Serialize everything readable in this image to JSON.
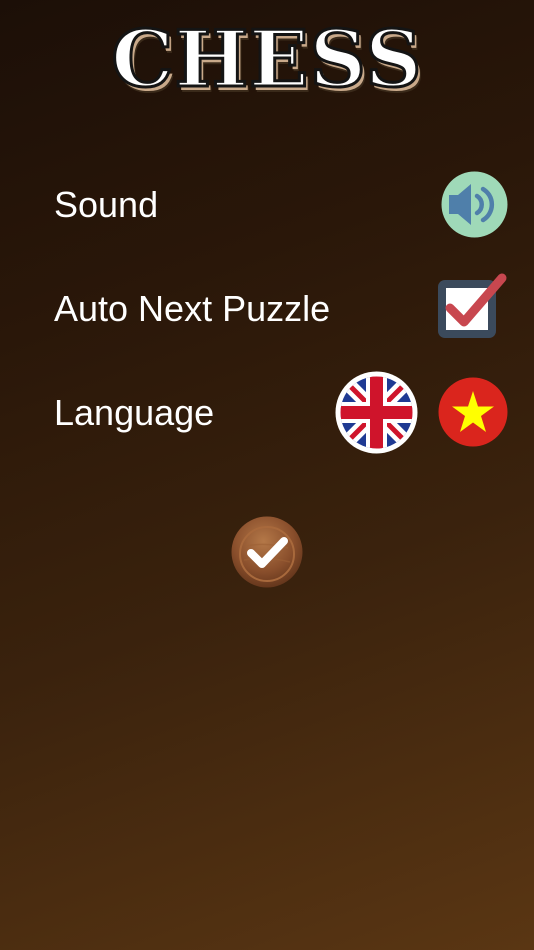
{
  "app": {
    "title": "CHESS"
  },
  "settings": {
    "sound": {
      "label": "Sound",
      "icon": "speaker-icon",
      "enabled": true
    },
    "auto_next": {
      "label": "Auto Next Puzzle",
      "icon": "checkbox-checked-icon",
      "checked": true
    },
    "language": {
      "label": "Language",
      "options": [
        {
          "code": "en",
          "icon": "uk-flag-icon"
        },
        {
          "code": "vi",
          "icon": "vietnam-flag-icon"
        }
      ]
    }
  },
  "confirm": {
    "icon": "checkmark-icon"
  },
  "colors": {
    "sound_bg": "#9fd9b8",
    "speaker": "#4f7faa",
    "checkbox_frame": "#3b4a5c",
    "checkmark": "#c8474f",
    "vn_red": "#da251d",
    "vn_star": "#ffff00",
    "wood": "#8a4f2c"
  }
}
